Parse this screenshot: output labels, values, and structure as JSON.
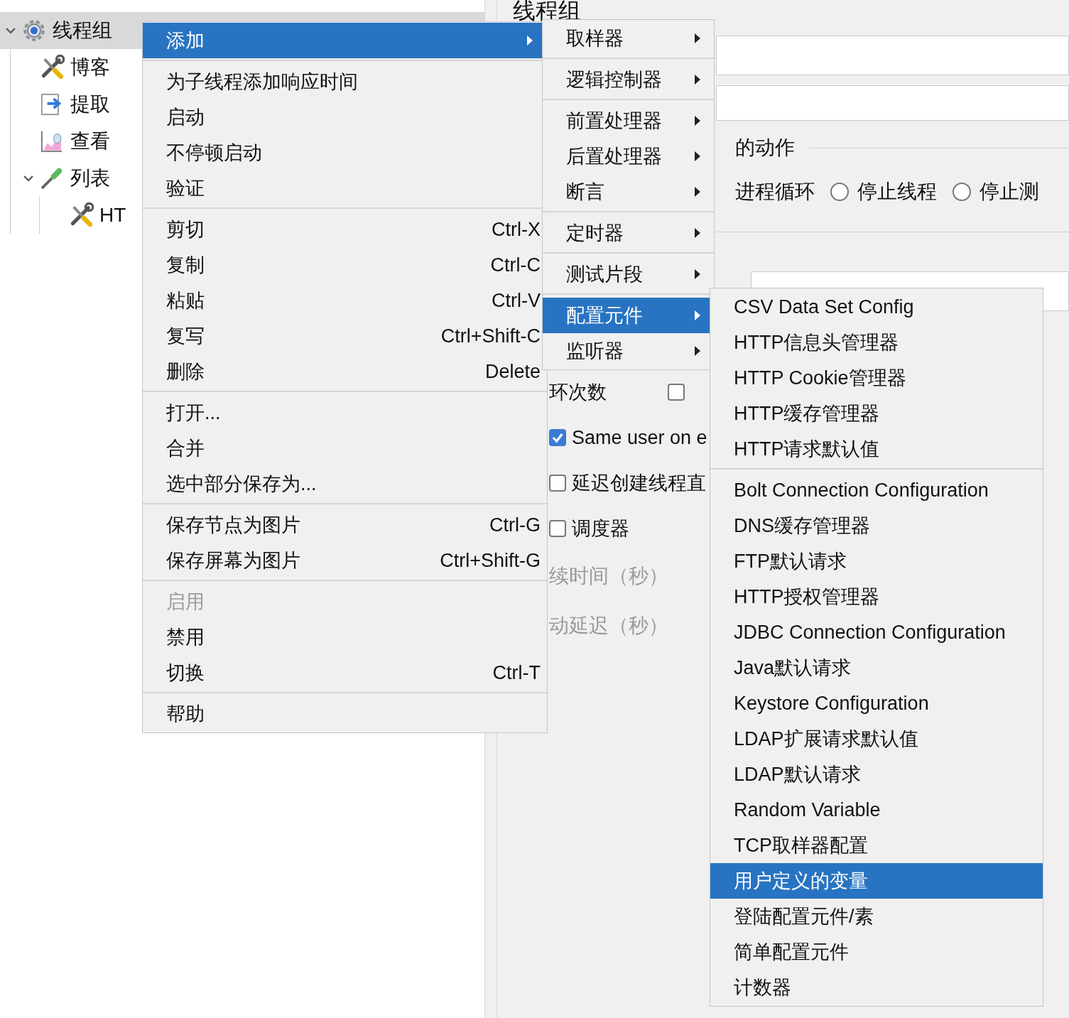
{
  "tree": {
    "items": [
      {
        "label": "线程组",
        "kind": "gear",
        "expanded": true,
        "selected": true,
        "children": [
          {
            "label": "博客",
            "kind": "tools",
            "selected": false
          },
          {
            "label": "提取",
            "kind": "extractor",
            "selected": false
          },
          {
            "label": "查看",
            "kind": "chart",
            "selected": false
          },
          {
            "label": "列表",
            "kind": "dropper",
            "expanded": true,
            "selected": false,
            "children": [
              {
                "label": "HT",
                "kind": "tools",
                "selected": false
              }
            ]
          }
        ]
      }
    ]
  },
  "panel": {
    "title": "线程组",
    "action_section": {
      "label": "的动作",
      "options": [
        {
          "label": "进程循环"
        },
        {
          "label": "停止线程",
          "selected": false
        },
        {
          "label": "停止测",
          "selected": false
        }
      ]
    },
    "loop": {
      "label": "环次数",
      "checked": false
    },
    "options": [
      {
        "label": "Same user on e",
        "checked": true
      },
      {
        "label": "延迟创建线程直",
        "checked": false
      },
      {
        "label": "调度器",
        "checked": false
      }
    ],
    "fields": [
      {
        "label": "续时间（秒）",
        "disabled": true
      },
      {
        "label": "动延迟（秒）",
        "disabled": true
      }
    ]
  },
  "menus": [
    {
      "items": [
        {
          "kind": "item",
          "label": "添加",
          "submenu": true,
          "selected": true,
          "disabled": false
        },
        {
          "kind": "separator"
        },
        {
          "kind": "item",
          "label": "为子线程添加响应时间",
          "selected": false,
          "disabled": false
        },
        {
          "kind": "item",
          "label": "启动",
          "selected": false,
          "disabled": false
        },
        {
          "kind": "item",
          "label": "不停顿启动",
          "selected": false,
          "disabled": false
        },
        {
          "kind": "item",
          "label": "验证",
          "selected": false,
          "disabled": false
        },
        {
          "kind": "separator"
        },
        {
          "kind": "item",
          "label": "剪切",
          "shortcut": "Ctrl-X",
          "selected": false,
          "disabled": false
        },
        {
          "kind": "item",
          "label": "复制",
          "shortcut": "Ctrl-C",
          "selected": false,
          "disabled": false
        },
        {
          "kind": "item",
          "label": "粘贴",
          "shortcut": "Ctrl-V",
          "selected": false,
          "disabled": false
        },
        {
          "kind": "item",
          "label": "复写",
          "shortcut": "Ctrl+Shift-C",
          "selected": false,
          "disabled": false
        },
        {
          "kind": "item",
          "label": "删除",
          "shortcut": "Delete",
          "selected": false,
          "disabled": false
        },
        {
          "kind": "separator"
        },
        {
          "kind": "item",
          "label": "打开...",
          "selected": false,
          "disabled": false
        },
        {
          "kind": "item",
          "label": "合并",
          "selected": false,
          "disabled": false
        },
        {
          "kind": "item",
          "label": "选中部分保存为...",
          "selected": false,
          "disabled": false
        },
        {
          "kind": "separator"
        },
        {
          "kind": "item",
          "label": "保存节点为图片",
          "shortcut": "Ctrl-G",
          "selected": false,
          "disabled": false
        },
        {
          "kind": "item",
          "label": "保存屏幕为图片",
          "shortcut": "Ctrl+Shift-G",
          "selected": false,
          "disabled": false
        },
        {
          "kind": "separator"
        },
        {
          "kind": "item",
          "label": "启用",
          "selected": false,
          "disabled": true
        },
        {
          "kind": "item",
          "label": "禁用",
          "selected": false,
          "disabled": false
        },
        {
          "kind": "item",
          "label": "切换",
          "shortcut": "Ctrl-T",
          "selected": false,
          "disabled": false
        },
        {
          "kind": "separator"
        },
        {
          "kind": "item",
          "label": "帮助",
          "selected": false,
          "disabled": false
        }
      ]
    },
    {
      "items": [
        {
          "kind": "item",
          "label": "取样器",
          "submenu": true,
          "selected": false
        },
        {
          "kind": "separator"
        },
        {
          "kind": "item",
          "label": "逻辑控制器",
          "submenu": true,
          "selected": false
        },
        {
          "kind": "separator"
        },
        {
          "kind": "item",
          "label": "前置处理器",
          "submenu": true,
          "selected": false
        },
        {
          "kind": "item",
          "label": "后置处理器",
          "submenu": true,
          "selected": false
        },
        {
          "kind": "item",
          "label": "断言",
          "submenu": true,
          "selected": false
        },
        {
          "kind": "separator"
        },
        {
          "kind": "item",
          "label": "定时器",
          "submenu": true,
          "selected": false
        },
        {
          "kind": "separator"
        },
        {
          "kind": "item",
          "label": "测试片段",
          "submenu": true,
          "selected": false
        },
        {
          "kind": "separator"
        },
        {
          "kind": "item",
          "label": "配置元件",
          "submenu": true,
          "selected": true
        },
        {
          "kind": "item",
          "label": "监听器",
          "submenu": true,
          "selected": false
        }
      ]
    },
    {
      "items": [
        {
          "kind": "item",
          "label": "CSV Data Set Config",
          "selected": false
        },
        {
          "kind": "item",
          "label": "HTTP信息头管理器",
          "selected": false
        },
        {
          "kind": "item",
          "label": "HTTP Cookie管理器",
          "selected": false
        },
        {
          "kind": "item",
          "label": "HTTP缓存管理器",
          "selected": false
        },
        {
          "kind": "item",
          "label": "HTTP请求默认值",
          "selected": false
        },
        {
          "kind": "separator"
        },
        {
          "kind": "item",
          "label": "Bolt Connection Configuration",
          "selected": false
        },
        {
          "kind": "item",
          "label": "DNS缓存管理器",
          "selected": false
        },
        {
          "kind": "item",
          "label": "FTP默认请求",
          "selected": false
        },
        {
          "kind": "item",
          "label": "HTTP授权管理器",
          "selected": false
        },
        {
          "kind": "item",
          "label": "JDBC Connection Configuration",
          "selected": false
        },
        {
          "kind": "item",
          "label": "Java默认请求",
          "selected": false
        },
        {
          "kind": "item",
          "label": "Keystore Configuration",
          "selected": false
        },
        {
          "kind": "item",
          "label": "LDAP扩展请求默认值",
          "selected": false
        },
        {
          "kind": "item",
          "label": "LDAP默认请求",
          "selected": false
        },
        {
          "kind": "item",
          "label": "Random Variable",
          "selected": false
        },
        {
          "kind": "item",
          "label": "TCP取样器配置",
          "selected": false
        },
        {
          "kind": "item",
          "label": "用户定义的变量",
          "selected": true
        },
        {
          "kind": "item",
          "label": "登陆配置元件/素",
          "selected": false
        },
        {
          "kind": "item",
          "label": "简单配置元件",
          "selected": false
        },
        {
          "kind": "item",
          "label": "计数器",
          "selected": false
        }
      ]
    }
  ]
}
